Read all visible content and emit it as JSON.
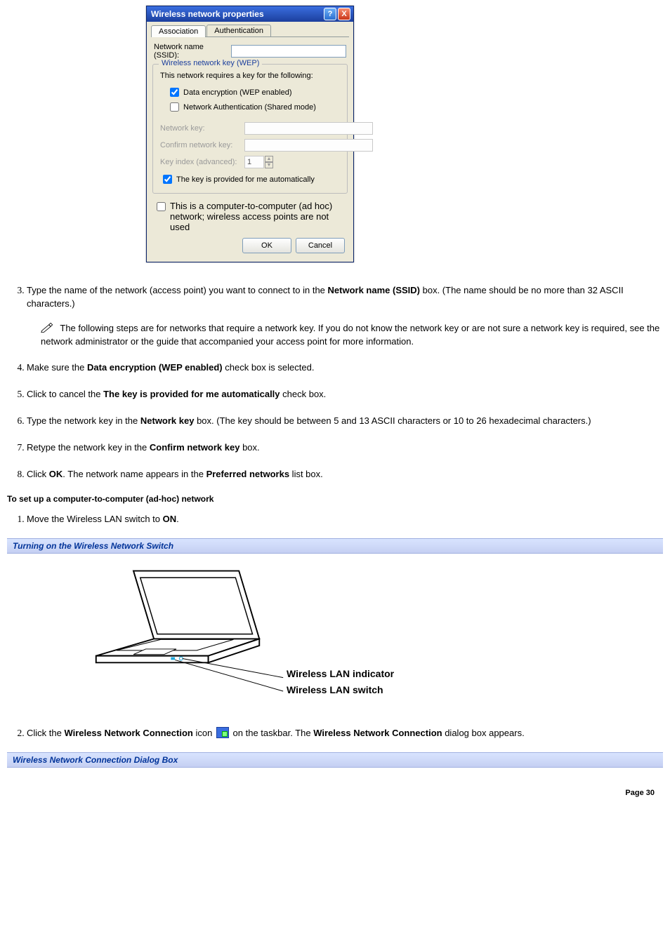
{
  "dialog": {
    "title": "Wireless network properties",
    "tabs": {
      "association": "Association",
      "authentication": "Authentication"
    },
    "ssid_label": "Network name (SSID):",
    "group_legend": "Wireless network key (WEP)",
    "group_intro": "This network requires a key for the following:",
    "cb_data_enc": "Data encryption (WEP enabled)",
    "cb_net_auth": "Network Authentication (Shared mode)",
    "netkey_label": "Network key:",
    "confirm_label": "Confirm network key:",
    "keyindex_label": "Key index (advanced):",
    "keyindex_value": "1",
    "cb_auto_key": "The key is provided for me automatically",
    "cb_adhoc": "This is a computer-to-computer (ad hoc) network; wireless access points are not used",
    "ok": "OK",
    "cancel": "Cancel"
  },
  "list_a": {
    "i3_pre": "Type the name of the network (access point) you want to connect to in the ",
    "i3_bold": "Network name (SSID)",
    "i3_post": " box. (The name should be no more than 32 ASCII characters.)",
    "note": "The following steps are for networks that require a network key. If you do not know the network key or are not sure a network key is required, see the network administrator or the guide that accompanied your access point for more information.",
    "i4_pre": "Make sure the ",
    "i4_bold": "Data encryption (WEP enabled)",
    "i4_post": " check box is selected.",
    "i5_pre": "Click to cancel the ",
    "i5_bold": "The key is provided for me automatically",
    "i5_post": " check box.",
    "i6_pre": "Type the network key in the ",
    "i6_bold": "Network key",
    "i6_post": " box. (The key should be between 5 and 13 ASCII characters or 10 to 26 hexadecimal characters.)",
    "i7_pre": "Retype the network key in the ",
    "i7_bold": "Confirm network key",
    "i7_post": " box.",
    "i8_pre": "Click ",
    "i8_bold1": "OK",
    "i8_mid": ". The network name appears in the ",
    "i8_bold2": "Preferred networks",
    "i8_post": " list box."
  },
  "subhead": "To set up a computer-to-computer (ad-hoc) network",
  "list_b": {
    "i1_pre": "Move the Wireless LAN switch to ",
    "i1_bold": "ON",
    "i1_post": ".",
    "i2_pre": "Click the ",
    "i2_bold1": "Wireless Network Connection",
    "i2_mid1": " icon ",
    "i2_mid2": " on the taskbar. The ",
    "i2_bold2": "Wireless Network Connection",
    "i2_post": " dialog box appears."
  },
  "caption1": "Turning on the Wireless Network Switch",
  "fig_labels": {
    "indicator": "Wireless LAN indicator",
    "switch": "Wireless LAN switch"
  },
  "caption2": "Wireless Network Connection Dialog Box",
  "page_num": "Page 30"
}
